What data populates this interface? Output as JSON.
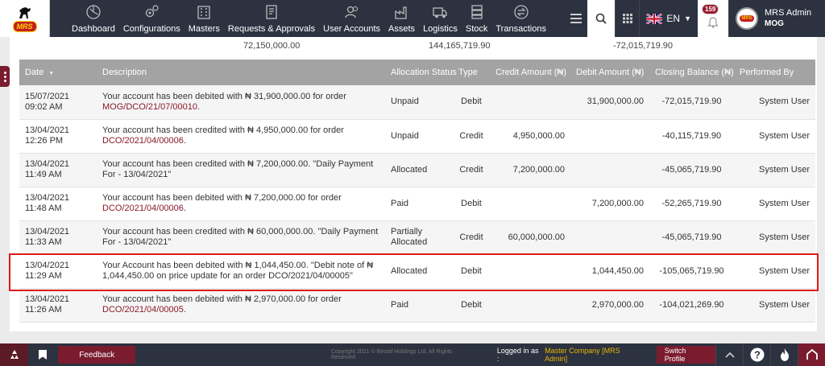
{
  "brand": {
    "logo_text": "MRS"
  },
  "nav": {
    "items": [
      {
        "label": "Dashboard",
        "icon": "dashboard-icon"
      },
      {
        "label": "Configurations",
        "icon": "gears-icon"
      },
      {
        "label": "Masters",
        "icon": "building-icon"
      },
      {
        "label": "Requests & Approvals",
        "icon": "document-icon"
      },
      {
        "label": "User Accounts",
        "icon": "users-icon"
      },
      {
        "label": "Assets",
        "icon": "factory-icon"
      },
      {
        "label": "Logistics",
        "icon": "truck-icon"
      },
      {
        "label": "Stock",
        "icon": "stack-icon"
      },
      {
        "label": "Transactions",
        "icon": "exchange-icon"
      }
    ],
    "language": "EN",
    "notification_count": "159",
    "user": {
      "name": "MRS Admin",
      "company": "MOG"
    }
  },
  "summary": {
    "v1": "72,150,000.00",
    "v2": "144,165,719.90",
    "v3": "-72,015,719.90"
  },
  "table": {
    "columns": [
      "Date",
      "Description",
      "Allocation Status",
      "Type",
      "Credit Amount (₦)",
      "Debit Amount (₦)",
      "Closing Balance (₦)",
      "Performed By"
    ],
    "rows": [
      {
        "date": "15/07/2021",
        "time": "09:02 AM",
        "desc": "Your account has been debited with ₦ 31,900,000.00 for order",
        "ref": "MOG/DCO/21/07/00010",
        "ref_suffix": ".",
        "status": "Unpaid",
        "type": "Debit",
        "credit": "",
        "debit": "31,900,000.00",
        "balance": "-72,015,719.90",
        "by": "System User"
      },
      {
        "date": "13/04/2021",
        "time": "12:26 PM",
        "desc": "Your account has been credited with ₦ 4,950,000.00 for order",
        "ref": "DCO/2021/04/00006",
        "ref_suffix": ".",
        "status": "Unpaid",
        "type": "Credit",
        "credit": "4,950,000.00",
        "debit": "",
        "balance": "-40,115,719.90",
        "by": "System User"
      },
      {
        "date": "13/04/2021",
        "time": "11:49 AM",
        "desc": "Your account has been credited with ₦ 7,200,000.00. \"Daily Payment For - 13/04/2021\"",
        "ref": "",
        "ref_suffix": "",
        "status": "Allocated",
        "type": "Credit",
        "credit": "7,200,000.00",
        "debit": "",
        "balance": "-45,065,719.90",
        "by": "System User"
      },
      {
        "date": "13/04/2021",
        "time": "11:48 AM",
        "desc": "Your account has been debited with ₦ 7,200,000.00 for order",
        "ref": "DCO/2021/04/00006",
        "ref_suffix": ".",
        "status": "Paid",
        "type": "Debit",
        "credit": "",
        "debit": "7,200,000.00",
        "balance": "-52,265,719.90",
        "by": "System User"
      },
      {
        "date": "13/04/2021",
        "time": "11:33 AM",
        "desc": "Your account has been credited with ₦ 60,000,000.00. \"Daily Payment For - 13/04/2021\"",
        "ref": "",
        "ref_suffix": "",
        "status": "Partially Allocated",
        "type": "Credit",
        "credit": "60,000,000.00",
        "debit": "",
        "balance": "-45,065,719.90",
        "by": "System User"
      },
      {
        "date": "13/04/2021",
        "time": "11:29 AM",
        "desc": "Your Account has been debited with ₦ 1,044,450.00. \"Debit note of ₦ 1,044,450.00 on price update for an order DCO/2021/04/00005\"",
        "ref": "",
        "ref_suffix": "",
        "status": "Allocated",
        "type": "Debit",
        "credit": "",
        "debit": "1,044,450.00",
        "balance": "-105,065,719.90",
        "by": "System User"
      },
      {
        "date": "13/04/2021",
        "time": "11:26 AM",
        "desc": "Your account has been debited with ₦ 2,970,000.00 for order",
        "ref": "DCO/2021/04/00005",
        "ref_suffix": ".",
        "status": "Paid",
        "type": "Debit",
        "credit": "",
        "debit": "2,970,000.00",
        "balance": "-104,021,269.90",
        "by": "System User"
      }
    ]
  },
  "footer": {
    "feedback": "Feedback",
    "copyright": "Copyright 2021 © Bestaf Holdings Ltd. All Rights Reserved",
    "logged_in_label": "Logged in as :",
    "company": "Master Company [MRS Admin]",
    "switch_profile": "Switch Profile"
  }
}
